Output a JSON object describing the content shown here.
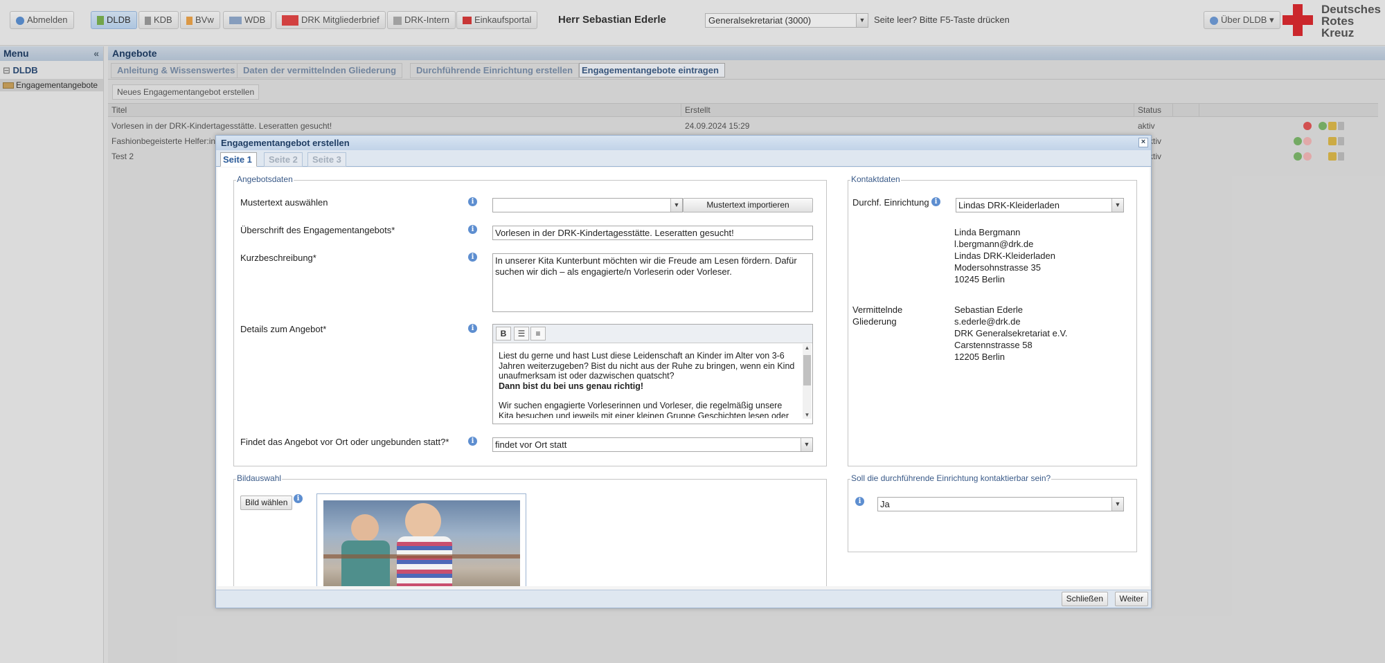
{
  "toolbar": {
    "logout": "Abmelden",
    "dldb": "DLDB",
    "kdb": "KDB",
    "bvw": "BVw",
    "wdb": "WDB",
    "drk_letter": "DRK Mitgliederbrief",
    "drk_intern": "DRK-Intern",
    "shop": "Einkaufsportal",
    "user": "Herr Sebastian Ederle",
    "org_select": "Generalsekretariat (3000)",
    "hint": "Seite leer? Bitte F5-Taste drücken",
    "about": "Über DLDB",
    "logo_lines": [
      "Deutsches",
      "Rotes",
      "Kreuz"
    ]
  },
  "menu": {
    "title": "Menu",
    "collapse_icon": "«",
    "root": "DLDB",
    "item": "Engagementangebote"
  },
  "main": {
    "title": "Angebote",
    "tabs": [
      "Anleitung & Wissenswertes",
      "Daten der vermittelnden Gliederung",
      "Durchführende Einrichtung erstellen",
      "Engagementangebote eintragen"
    ],
    "new_button": "Neues Engagementangebot erstellen",
    "columns": [
      "Titel",
      "Erstellt",
      "Status"
    ],
    "rows": [
      {
        "title": "Vorlesen in der DRK-Kindertagesstätte. Leseratten gesucht!",
        "created": "24.09.2024 15:29",
        "status": "aktiv"
      },
      {
        "title": "Fashionbegeisterte Helfer:in",
        "created": "",
        "status": "inaktiv"
      },
      {
        "title": "Test 2",
        "created": "",
        "status": "inaktiv"
      }
    ]
  },
  "modal": {
    "title": "Engagementangebot erstellen",
    "close": "×",
    "tabs": [
      "Seite 1",
      "Seite 2",
      "Seite 3"
    ],
    "offer_legend": "Angebotsdaten",
    "template_label": "Mustertext auswählen",
    "template_value": "",
    "template_button": "Mustertext importieren",
    "heading_label": "Überschrift des Engagementangebots*",
    "heading_value": "Vorlesen in der DRK-Kindertagesstätte. Leseratten gesucht!",
    "short_label": "Kurzbeschreibung*",
    "short_value": "In unserer Kita Kunterbunt möchten wir die Freude am Lesen fördern. Dafür suchen wir dich – als engagierte/n Vorleserin oder Vorleser.",
    "details_label": "Details zum Angebot*",
    "editor_buttons": [
      "B",
      "list-bullet",
      "list-numbered"
    ],
    "details_p1": "Liest du gerne und hast Lust diese Leidenschaft an Kinder im Alter von 3-6 Jahren weiterzugeben? Bist du nicht aus der Ruhe zu bringen, wenn ein Kind unaufmerksam ist oder dazwischen quatscht?",
    "details_bold": "Dann bist du bei uns genau richtig!",
    "details_p2": "Wir suchen engagierte Vorleserinnen und Vorleser, die regelmäßig unsere Kita besuchen und jeweils mit einer kleinen Gruppe Geschichten lesen oder",
    "location_label": "Findet das Angebot vor Ort oder ungebunden statt?*",
    "location_value": "findet vor Ort statt",
    "contact_legend": "Kontaktdaten",
    "facility_label": "Durchf. Einrichtung",
    "facility_value": "Lindas DRK-Kleiderladen",
    "facility_contact": [
      "Linda Bergmann",
      "l.bergmann@drk.de",
      "Lindas DRK-Kleiderladen",
      "Modersohnstrasse 35",
      "10245 Berlin"
    ],
    "mediator_label": [
      "Vermittelnde",
      "Gliederung"
    ],
    "mediator_contact": [
      "Sebastian Ederle",
      "s.ederle@drk.de",
      "DRK Generalsekretariat e.V.",
      "Carstennstrasse 58",
      "12205 Berlin"
    ],
    "image_legend": "Bildauswahl",
    "image_button": "Bild wählen",
    "reachable_legend": "Soll die durchführende Einrichtung kontaktierbar sein?",
    "reachable_value": "Ja",
    "close_button": "Schließen",
    "next_button": "Weiter"
  }
}
